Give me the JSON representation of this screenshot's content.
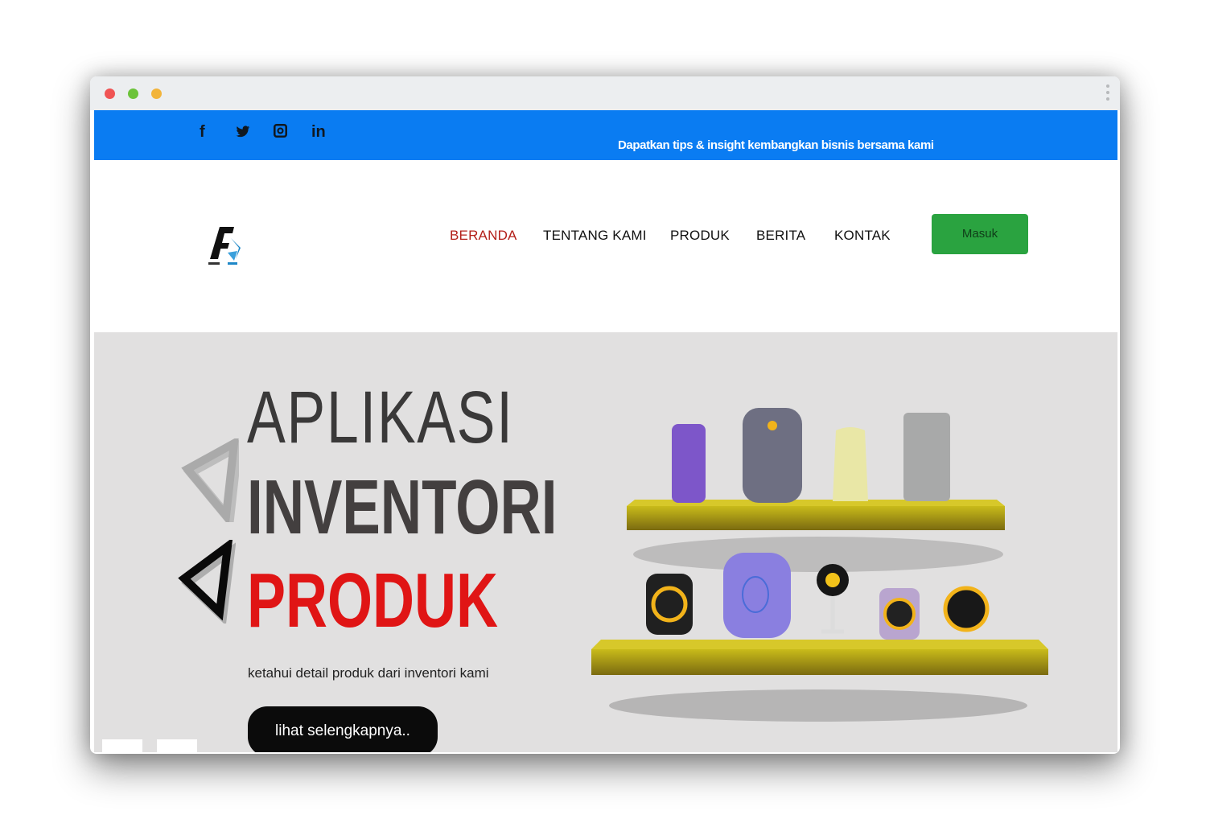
{
  "topbar": {
    "social": [
      {
        "icon": "facebook-icon",
        "glyph": "f"
      },
      {
        "icon": "twitter-icon",
        "glyph": "🐦"
      },
      {
        "icon": "instagram-icon",
        "glyph": "◙"
      },
      {
        "icon": "linkedin-icon",
        "glyph": "in"
      }
    ],
    "tagline": "Dapatkan tips & insight kembangkan bisnis bersama kami"
  },
  "nav": {
    "items": [
      {
        "label": "BERANDA",
        "active": true
      },
      {
        "label": "TENTANG KAMI"
      },
      {
        "label": "PRODUK"
      },
      {
        "label": "BERITA"
      },
      {
        "label": "KONTAK"
      }
    ],
    "login_label": "Masuk"
  },
  "hero": {
    "line1": "APLIKASI",
    "line2": "INVENTORI",
    "line3": "PRODUK",
    "subtitle": "ketahui detail produk dari inventori kami",
    "cta": "lihat selengkapnya.."
  },
  "colors": {
    "topbar": "#0a7cf2",
    "active_nav": "#b3201a",
    "login": "#2aa340",
    "hero_bg": "#e1e0e0",
    "accent_red": "#e01515"
  }
}
